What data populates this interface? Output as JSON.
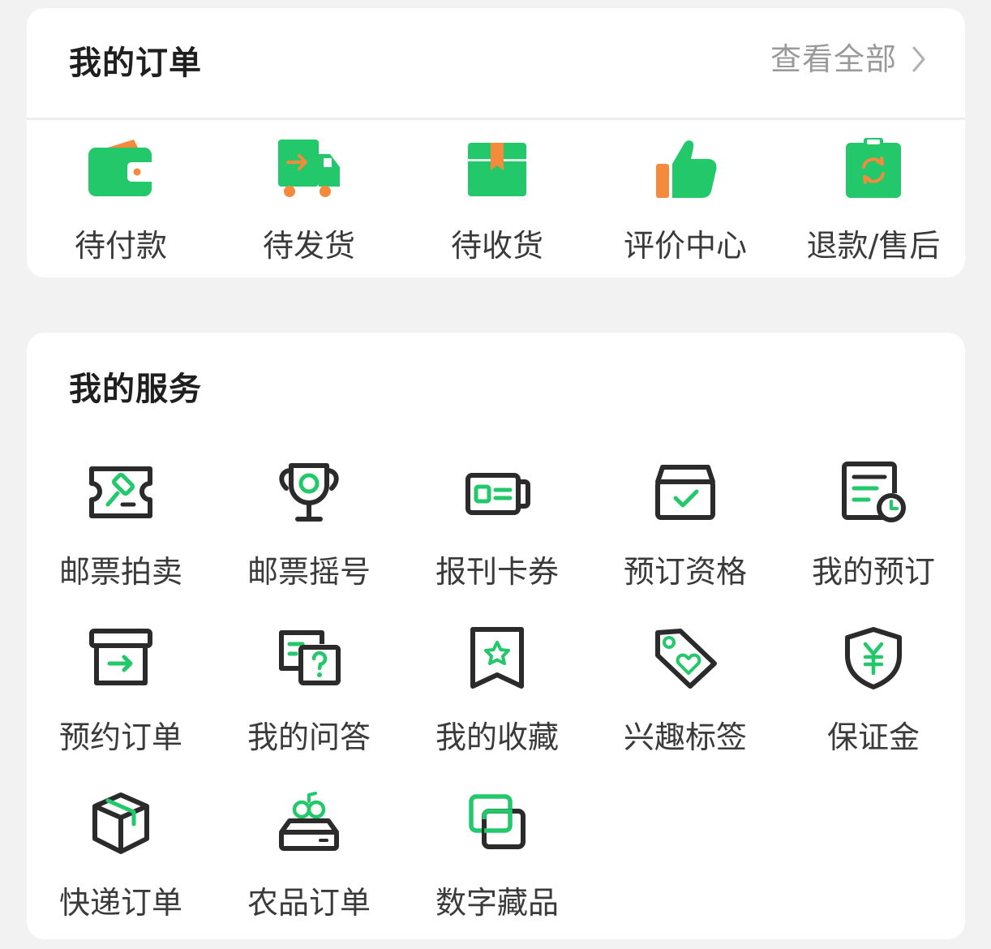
{
  "orders": {
    "title": "我的订单",
    "view_all": "查看全部",
    "items": [
      {
        "label": "待付款",
        "icon": "wallet-icon"
      },
      {
        "label": "待发货",
        "icon": "delivery-truck-icon"
      },
      {
        "label": "待收货",
        "icon": "package-box-icon"
      },
      {
        "label": "评价中心",
        "icon": "thumbs-up-icon"
      },
      {
        "label": "退款/售后",
        "icon": "refund-clipboard-icon"
      }
    ]
  },
  "services": {
    "title": "我的服务",
    "items": [
      {
        "label": "邮票拍卖",
        "icon": "auction-ticket-icon"
      },
      {
        "label": "邮票摇号",
        "icon": "trophy-icon"
      },
      {
        "label": "报刊卡券",
        "icon": "card-coupon-icon"
      },
      {
        "label": "预订资格",
        "icon": "reservation-box-check-icon"
      },
      {
        "label": "我的预订",
        "icon": "document-clock-icon"
      },
      {
        "label": "预约订单",
        "icon": "box-arrow-icon"
      },
      {
        "label": "我的问答",
        "icon": "question-chat-icon"
      },
      {
        "label": "我的收藏",
        "icon": "bookmark-star-icon"
      },
      {
        "label": "兴趣标签",
        "icon": "tag-heart-icon"
      },
      {
        "label": "保证金",
        "icon": "shield-yen-icon"
      },
      {
        "label": "快递订单",
        "icon": "parcel-cube-icon"
      },
      {
        "label": "农品订单",
        "icon": "produce-crate-icon"
      },
      {
        "label": "数字藏品",
        "icon": "digital-collection-icon"
      }
    ]
  },
  "colors": {
    "accent_green": "#22c86a",
    "accent_orange": "#f58a3c",
    "outline_dark": "#2b2b2b",
    "text_primary": "#1f1f1f",
    "text_secondary": "#3a3a3a",
    "text_muted": "#9a9a9a",
    "background": "#f2f2f2"
  }
}
